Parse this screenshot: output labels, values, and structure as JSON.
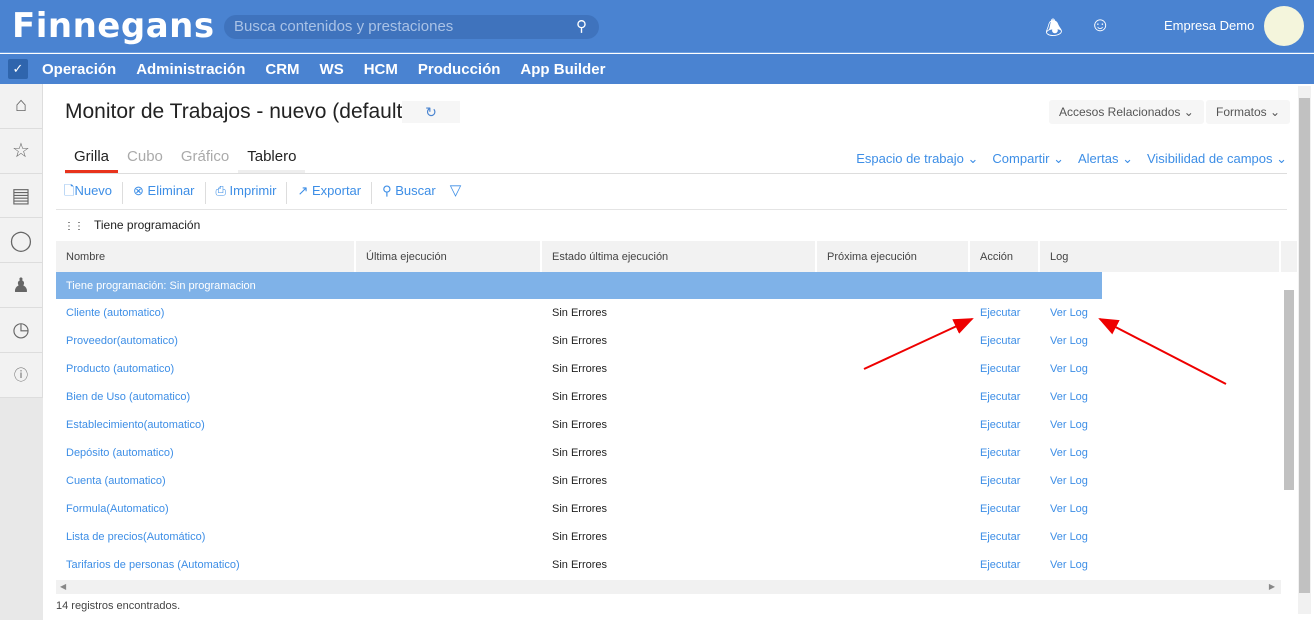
{
  "header": {
    "logo": "Finnegans",
    "search_placeholder": "Busca contenidos y prestaciones",
    "company": "Empresa Demo"
  },
  "nav": [
    "Operación",
    "Administración",
    "CRM",
    "WS",
    "HCM",
    "Producción",
    "App Builder"
  ],
  "page": {
    "title": "Monitor de Trabajos - nuevo (default)",
    "accesos": "Accesos Relacionados",
    "formatos": "Formatos"
  },
  "tabs": [
    "Grilla",
    "Cubo",
    "Gráfico",
    "Tablero"
  ],
  "links": [
    "Espacio de trabajo",
    "Compartir",
    "Alertas",
    "Visibilidad de campos"
  ],
  "toolbar": [
    "Nuevo",
    "Eliminar",
    "Imprimir",
    "Exportar",
    "Buscar"
  ],
  "group_by": "Tiene programación",
  "columns": [
    "Nombre",
    "Última ejecución",
    "Estado última ejecución",
    "Próxima ejecución",
    "Acción",
    "Log"
  ],
  "group_row": "Tiene programación: Sin programacion",
  "rows": [
    {
      "nombre": "Cliente (automatico)",
      "estado": "Sin Errores",
      "accion": "Ejecutar",
      "log": "Ver Log"
    },
    {
      "nombre": "Proveedor(automatico)",
      "estado": "Sin Errores",
      "accion": "Ejecutar",
      "log": "Ver Log"
    },
    {
      "nombre": "Producto (automatico)",
      "estado": "Sin Errores",
      "accion": "Ejecutar",
      "log": "Ver Log"
    },
    {
      "nombre": "Bien de Uso (automatico)",
      "estado": "Sin Errores",
      "accion": "Ejecutar",
      "log": "Ver Log"
    },
    {
      "nombre": "Establecimiento(automatico)",
      "estado": "Sin Errores",
      "accion": "Ejecutar",
      "log": "Ver Log"
    },
    {
      "nombre": "Depósito (automatico)",
      "estado": "Sin Errores",
      "accion": "Ejecutar",
      "log": "Ver Log"
    },
    {
      "nombre": "Cuenta (automatico)",
      "estado": "Sin Errores",
      "accion": "Ejecutar",
      "log": "Ver Log"
    },
    {
      "nombre": "Formula(Automatico)",
      "estado": "Sin Errores",
      "accion": "Ejecutar",
      "log": "Ver Log"
    },
    {
      "nombre": "Lista de precios(Automático)",
      "estado": "Sin Errores",
      "accion": "Ejecutar",
      "log": "Ver Log"
    },
    {
      "nombre": "Tarifarios de personas (Automatico)",
      "estado": "Sin Errores",
      "accion": "Ejecutar",
      "log": "Ver Log"
    }
  ],
  "footer": "14 registros encontrados."
}
